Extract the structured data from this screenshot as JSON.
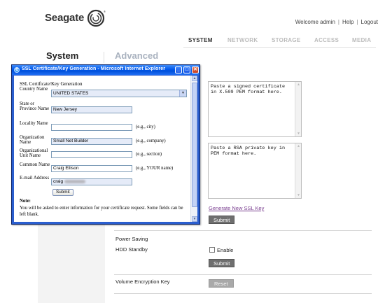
{
  "brand": {
    "logo_text": "Seagate"
  },
  "topnav": {
    "welcome": "Welcome admin",
    "separator": "|",
    "help": "Help",
    "logout": "Logout"
  },
  "tabs": [
    {
      "label": "SYSTEM",
      "active": true
    },
    {
      "label": "NETWORK",
      "active": false
    },
    {
      "label": "STORAGE",
      "active": false
    },
    {
      "label": "ACCESS",
      "active": false
    },
    {
      "label": "MEDIA",
      "active": false
    }
  ],
  "page": {
    "section_title": "System",
    "subsection_title": "Advanced"
  },
  "ssl": {
    "certificate_placeholder": "Paste a signed certificate in X.509 PEM format here.",
    "private_key_placeholder": "Paste a RSA private key in PEM format here.",
    "generate_link": "Generate New SSL Key",
    "submit_label": "Submit"
  },
  "power": {
    "heading": "Power Saving",
    "hdd_standby_label": "HDD Standby",
    "enable_label": "Enable",
    "enable_checked": false,
    "submit_label": "Submit"
  },
  "encryption": {
    "label": "Volume Encryption Key",
    "reset_label": "Reset"
  },
  "popup": {
    "window_title": "SSL Certificate/Key Generation - Microsoft Internet Explorer",
    "form_title": "SSL Certificate/Key Generation",
    "fields": {
      "country": {
        "label": "Country Name",
        "value": "UNITED STATES"
      },
      "state": {
        "label": "State or Province Name",
        "value": "New Jersey"
      },
      "locality": {
        "label": "Locality Name",
        "value": "",
        "hint": "(e.g., city)"
      },
      "organization": {
        "label": "Organization Name",
        "value": "Small Net Builder",
        "hint": "(e.g., company)"
      },
      "org_unit": {
        "label": "Organizational Unit Name",
        "value": "",
        "hint": "(e.g., section)"
      },
      "common_name": {
        "label": "Common Name",
        "value": "Craig Ellison",
        "hint": "(e.g., YOUR name)"
      },
      "email": {
        "label": "E-mail Address",
        "value": "craig"
      }
    },
    "submit_label": "Submit",
    "note_heading": "Note:",
    "note_text": "You will be asked to enter information for your certificate request. Some fields can be left blank."
  },
  "colors": {
    "titlebar_blue": "#0058ee",
    "link_purple": "#7a3f90",
    "advanced_title": "#a9b2bf",
    "dark_button": "#6f6f6f"
  },
  "icons": {
    "logo_mark": "seagate-swirl-icon",
    "ie_logo": "internet-explorer-icon",
    "minimize": "minimize-icon",
    "maximize": "maximize-icon",
    "close": "close-icon",
    "dropdown": "chevron-down-icon"
  }
}
